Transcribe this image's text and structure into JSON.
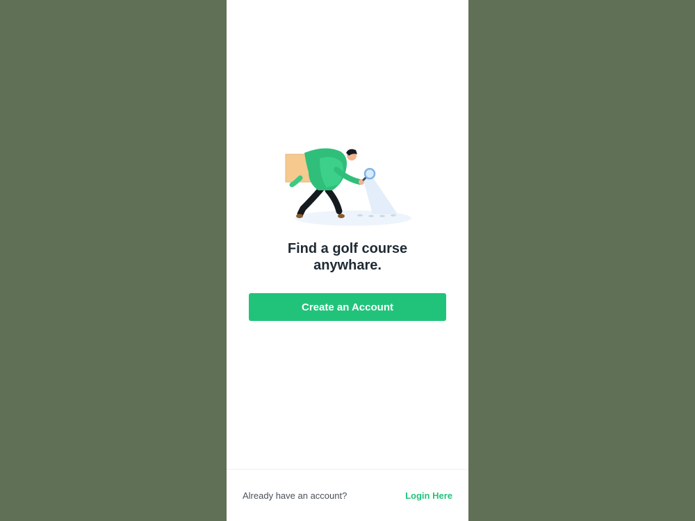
{
  "welcome": {
    "headline_line1": "Find a golf course",
    "headline_line2": "anywhare.",
    "create_account_label": "Create an Account"
  },
  "footer": {
    "prompt": "Already have an account?",
    "login_label": "Login Here"
  },
  "colors": {
    "background": "#5f7057",
    "panel": "#ffffff",
    "accent": "#21c37a",
    "heading": "#1f2a33"
  },
  "icons": {
    "illustration": "person-searching-with-magnifier-illustration"
  }
}
